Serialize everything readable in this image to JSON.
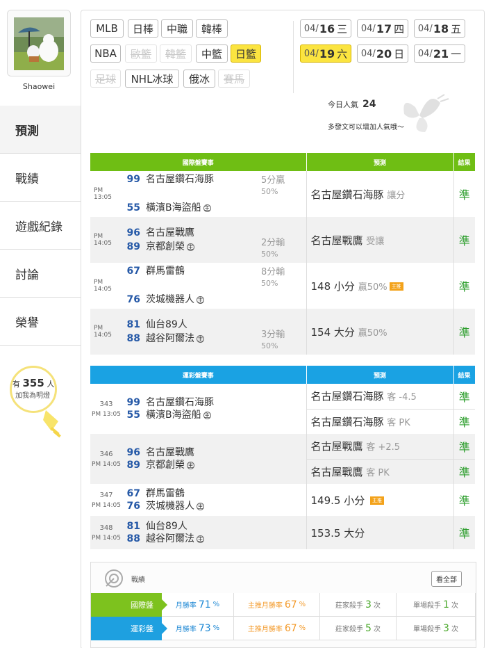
{
  "profile": {
    "username": "Shaowei"
  },
  "nav": {
    "items": [
      {
        "label": "預測",
        "active": true
      },
      {
        "label": "戰績"
      },
      {
        "label": "遊戲紀錄"
      },
      {
        "label": "討論"
      },
      {
        "label": "榮譽"
      }
    ]
  },
  "fans": {
    "prefix": "有",
    "count": "355",
    "suffix": "人",
    "note": "加我為明燈"
  },
  "sports": [
    {
      "label": "MLB",
      "state": "on"
    },
    {
      "label": "日棒",
      "state": "on"
    },
    {
      "label": "中職",
      "state": "on"
    },
    {
      "label": "韓棒",
      "state": "on"
    },
    {
      "label": "NBA",
      "state": "on"
    },
    {
      "label": "歐籃",
      "state": "disabled"
    },
    {
      "label": "韓籃",
      "state": "disabled"
    },
    {
      "label": "中籃",
      "state": "on"
    },
    {
      "label": "日籃",
      "state": "selected"
    },
    {
      "label": "足球",
      "state": "disabled"
    },
    {
      "label": "NHL冰球",
      "state": "on"
    },
    {
      "label": "俄冰",
      "state": "on"
    },
    {
      "label": "賽馬",
      "state": "disabled"
    }
  ],
  "dates": [
    {
      "md": "04/",
      "day": "16",
      "wd": "三"
    },
    {
      "md": "04/",
      "day": "17",
      "wd": "四"
    },
    {
      "md": "04/",
      "day": "18",
      "wd": "五"
    },
    {
      "md": "04/",
      "day": "19",
      "wd": "六",
      "selected": true
    },
    {
      "md": "04/",
      "day": "20",
      "wd": "日"
    },
    {
      "md": "04/",
      "day": "21",
      "wd": "一"
    }
  ],
  "popularity": {
    "label": "今日人氣",
    "value": "24",
    "hint": "多發文可以增加人氣哦～"
  },
  "intl": {
    "headers": [
      "國際盤賽事",
      "預測",
      "結果"
    ],
    "rows": [
      {
        "time": "PM 13:05",
        "away_score": "99",
        "away": "名古屋鑽石海豚",
        "home_score": "55",
        "home": "橫濱B海盜船",
        "line_a": "5分贏",
        "line_b": "50%",
        "pred": "名古屋鑽石海豚",
        "pred_note": "讓分",
        "badge": "",
        "result": "準"
      },
      {
        "time": "PM 14:05",
        "away_score": "96",
        "away": "名古屋戰鷹",
        "home_score": "89",
        "home": "京都創榮",
        "line_a": "2分輸",
        "line_b": "50%",
        "pred": "名古屋戰鷹",
        "pred_note": "受讓",
        "badge": "",
        "result": "準"
      },
      {
        "time": "PM 14:05",
        "away_score": "67",
        "away": "群馬雷鶴",
        "home_score": "76",
        "home": "茨城機器人",
        "line_a": "8分輸",
        "line_b": "50%",
        "pred": "148 小分",
        "pred_note": "贏50%",
        "badge": "主推",
        "result": "準"
      },
      {
        "time": "PM 14:05",
        "away_score": "81",
        "away": "仙台89人",
        "home_score": "88",
        "home": "越谷阿爾法",
        "line_a": "3分輸",
        "line_b": "50%",
        "pred": "154 大分",
        "pred_note": "贏50%",
        "badge": "",
        "result": "準"
      }
    ]
  },
  "sl": {
    "headers": [
      "運彩盤賽事",
      "預測",
      "結果"
    ],
    "rows": [
      {
        "num": "343",
        "time": "PM 13:05",
        "away_score": "99",
        "away": "名古屋鑽石海豚",
        "home_score": "55",
        "home": "橫濱B海盜船",
        "preds": [
          {
            "t": "名古屋鑽石海豚",
            "n": "客 -4.5",
            "r": "準"
          },
          {
            "t": "名古屋鑽石海豚",
            "n": "客 PK",
            "r": "準"
          }
        ]
      },
      {
        "num": "346",
        "time": "PM 14:05",
        "away_score": "96",
        "away": "名古屋戰鷹",
        "home_score": "89",
        "home": "京都創榮",
        "preds": [
          {
            "t": "名古屋戰鷹",
            "n": "客 +2.5",
            "r": "準"
          },
          {
            "t": "名古屋戰鷹",
            "n": "客 PK",
            "r": "準"
          }
        ]
      },
      {
        "num": "347",
        "time": "PM 14:05",
        "away_score": "67",
        "away": "群馬雷鶴",
        "home_score": "76",
        "home": "茨城機器人",
        "preds": [
          {
            "t": "149.5 小分",
            "n": "",
            "badge": "主推",
            "r": "準"
          }
        ]
      },
      {
        "num": "348",
        "time": "PM 14:05",
        "away_score": "81",
        "away": "仙台89人",
        "home_score": "88",
        "home": "越谷阿爾法",
        "preds": [
          {
            "t": "153.5 大分",
            "n": "",
            "r": "準"
          }
        ]
      }
    ]
  },
  "home_mark": "主",
  "record": {
    "title": "戰績",
    "view_all": "看全部",
    "rows": [
      {
        "label": "國際盤",
        "color": "#7dc21e",
        "c1": "月勝率",
        "v1": "71",
        "u1": "%",
        "c2": "主推月勝率",
        "v2": "67",
        "u2": "%",
        "c3": "莊家殺手",
        "v3": "3",
        "u3": "次",
        "c4": "單場殺手",
        "v4": "1",
        "u4": "次"
      },
      {
        "label": "運彩盤",
        "color": "#1ea0e0",
        "c1": "月勝率",
        "v1": "73",
        "u1": "%",
        "c2": "主推月勝率",
        "v2": "67",
        "u2": "%",
        "c3": "莊家殺手",
        "v3": "5",
        "u3": "次",
        "c4": "單場殺手",
        "v4": "3",
        "u4": "次"
      }
    ]
  },
  "colors": {
    "green_header": "#6fbe14",
    "blue_header": "#1aa2e3",
    "result": "#2a9d2a",
    "score": "#2659a7",
    "selected": "#fbe440"
  }
}
